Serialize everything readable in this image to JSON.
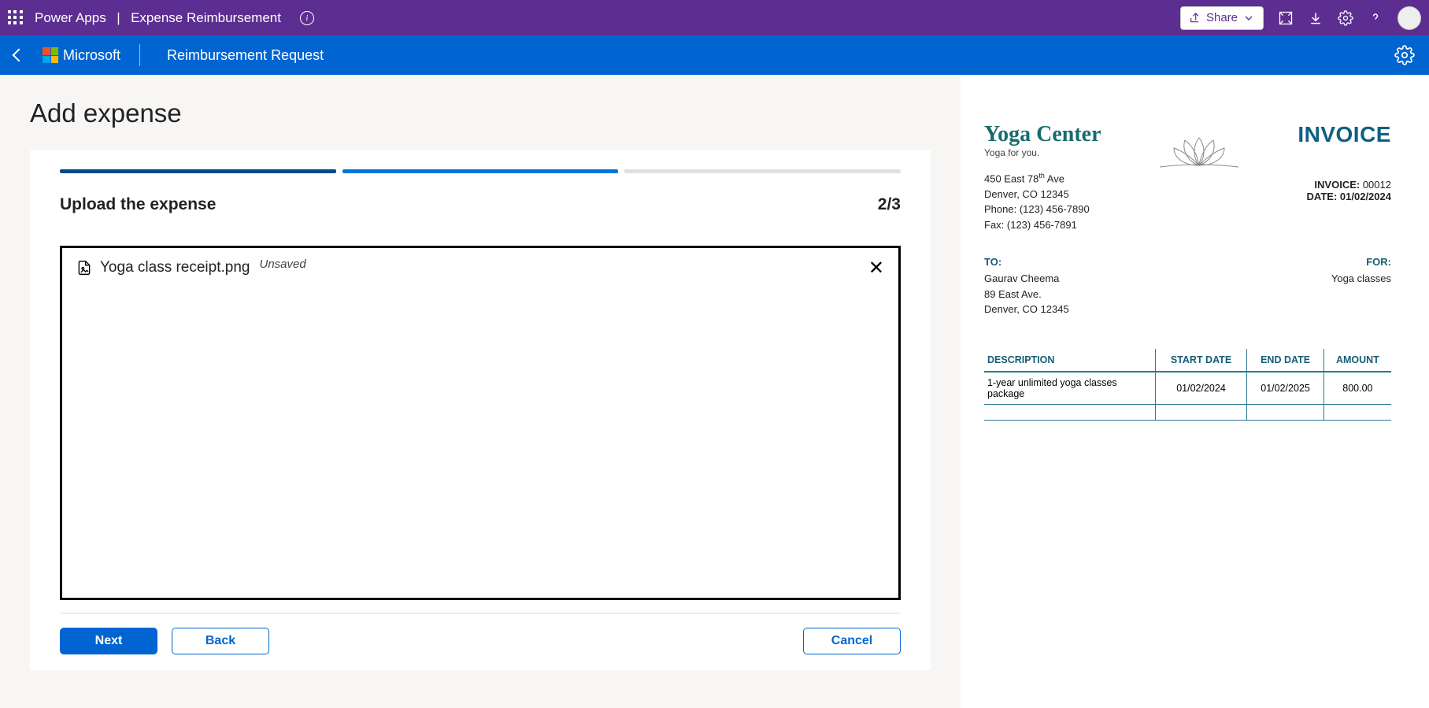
{
  "titlebar": {
    "product": "Power Apps",
    "app": "Expense Reimbursement",
    "share": "Share"
  },
  "appheader": {
    "brand": "Microsoft",
    "title": "Reimbursement Request"
  },
  "page": {
    "title": "Add expense"
  },
  "step": {
    "title": "Upload the expense",
    "counter": "2/3"
  },
  "upload": {
    "filename": "Yoga class receipt.png",
    "status": "Unsaved"
  },
  "buttons": {
    "next": "Next",
    "back": "Back",
    "cancel": "Cancel"
  },
  "invoice": {
    "brand": "Yoga Center",
    "tagline": "Yoga for you.",
    "title": "INVOICE",
    "address_line1_pre": "450 East 78",
    "address_line1_sup": "th",
    "address_line1_post": " Ave",
    "address_line2": "Denver, CO 12345",
    "address_line3": "Phone: (123) 456-7890",
    "address_line4": "Fax: (123) 456-7891",
    "meta_num_label": "INVOICE: ",
    "meta_num": "00012",
    "meta_date_label": "DATE: ",
    "meta_date": "01/02/2024",
    "to_label": "TO:",
    "to_line1": "Gaurav Cheema",
    "to_line2": "89 East Ave.",
    "to_line3": "Denver, CO 12345",
    "for_label": "FOR:",
    "for_text": "Yoga classes",
    "col_desc": "DESCRIPTION",
    "col_start": "START DATE",
    "col_end": "END DATE",
    "col_amount": "AMOUNT",
    "row_desc": "1-year unlimited yoga classes package",
    "row_start": "01/02/2024",
    "row_end": "01/02/2025",
    "row_amount": "800.00"
  }
}
